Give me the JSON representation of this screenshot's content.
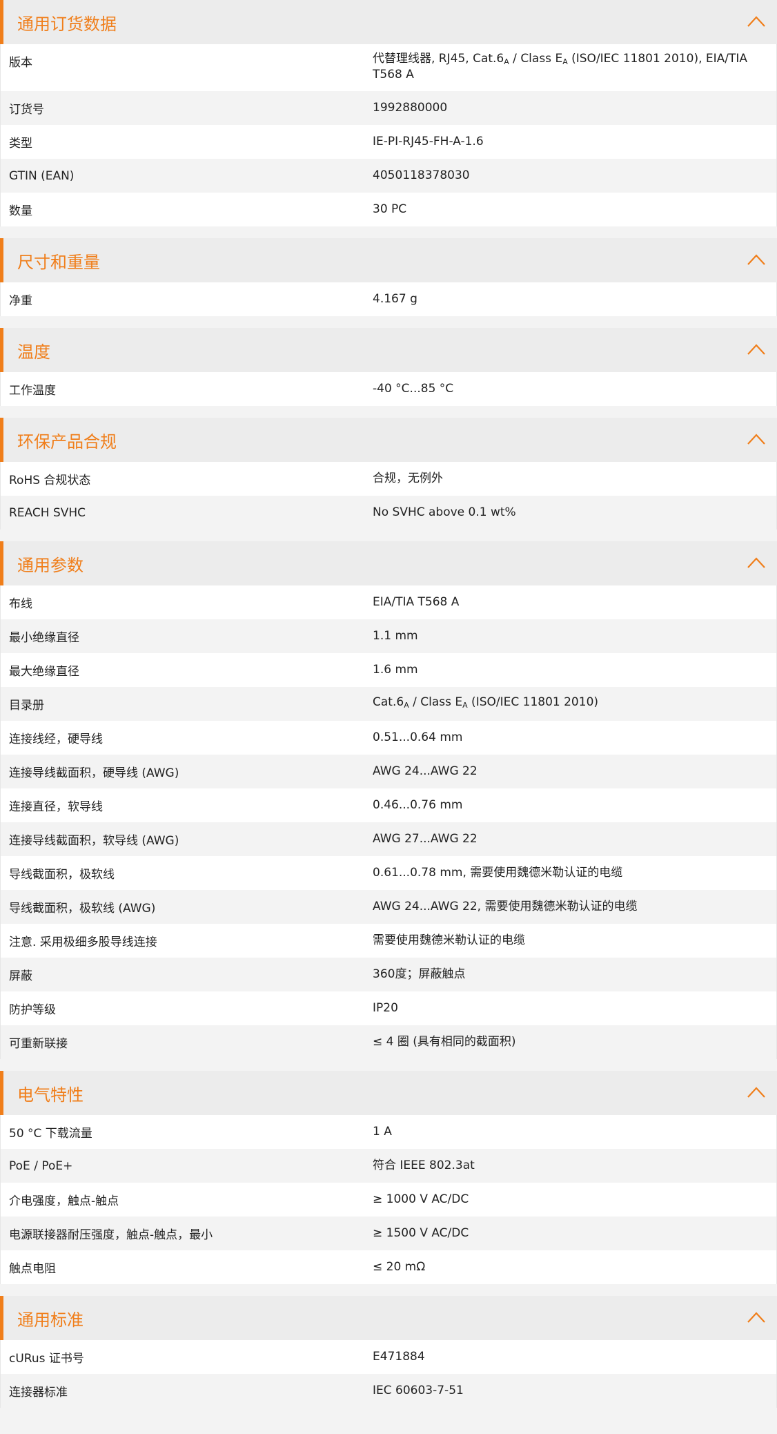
{
  "accent_color": "#f07e1a",
  "icons": {
    "section_toggle": "chevron-up-icon"
  },
  "sections": [
    {
      "id": "general-order",
      "title": "通用订货数据",
      "rows": [
        {
          "label": "版本",
          "value_parts": [
            {
              "t": "代替理线器, RJ45, Cat.6"
            },
            {
              "sub": "A"
            },
            {
              "t": " / Class E"
            },
            {
              "sub": "A"
            },
            {
              "t": " (ISO/IEC 11801 2010), EIA/TIA T568 A"
            }
          ]
        },
        {
          "label": "订货号",
          "value": "1992880000"
        },
        {
          "label": "类型",
          "value": "IE-PI-RJ45-FH-A-1.6"
        },
        {
          "label": "GTIN (EAN)",
          "value": "4050118378030"
        },
        {
          "label": "数量",
          "value": "30  PC"
        }
      ]
    },
    {
      "id": "dimensions-weight",
      "title": "尺寸和重量",
      "rows": [
        {
          "label": "净重",
          "value": "4.167  g"
        }
      ]
    },
    {
      "id": "temperature",
      "title": "温度",
      "rows": [
        {
          "label": "工作温度",
          "value": "-40 °C...85 °C"
        }
      ]
    },
    {
      "id": "environmental",
      "title": "环保产品合规",
      "rows": [
        {
          "label": "RoHS 合规状态",
          "value": "合规，无例外"
        },
        {
          "label": "REACH SVHC",
          "value": "No SVHC above 0.1 wt%"
        }
      ]
    },
    {
      "id": "general-params",
      "title": "通用参数",
      "rows": [
        {
          "label": "布线",
          "value": "EIA/TIA T568 A"
        },
        {
          "label": "最小绝缘直径",
          "value": "1.1  mm"
        },
        {
          "label": "最大绝缘直径",
          "value": "1.6  mm"
        },
        {
          "label": "目录册",
          "value_parts": [
            {
              "t": "Cat.6"
            },
            {
              "sub": "A"
            },
            {
              "t": " / Class E"
            },
            {
              "sub": "A"
            },
            {
              "t": " (ISO/IEC 11801 2010)"
            }
          ]
        },
        {
          "label": "连接线经，硬导线",
          "value": "0.51...0.64 mm"
        },
        {
          "label": "连接导线截面积，硬导线 (AWG)",
          "value": "AWG 24...AWG 22"
        },
        {
          "label": "连接直径，软导线",
          "value": "0.46...0.76 mm"
        },
        {
          "label": "连接导线截面积，软导线 (AWG)",
          "value": "AWG 27...AWG 22"
        },
        {
          "label": "导线截面积，极软线",
          "value": "0.61...0.78 mm, 需要使用魏德米勒认证的电缆"
        },
        {
          "label": "导线截面积，极软线 (AWG)",
          "value": "AWG 24...AWG 22, 需要使用魏德米勒认证的电缆"
        },
        {
          "label": "注意. 采用极细多股导线连接",
          "value": "需要使用魏德米勒认证的电缆"
        },
        {
          "label": "屏蔽",
          "value": "360度；屏蔽触点"
        },
        {
          "label": "防护等级",
          "value": "IP20"
        },
        {
          "label": "可重新联接",
          "value": "≤ 4 圈 (具有相同的截面积)"
        }
      ]
    },
    {
      "id": "electrical",
      "title": "电气特性",
      "rows": [
        {
          "label": "50 °C 下载流量",
          "value": "1  A"
        },
        {
          "label": "PoE / PoE+",
          "value": "符合 IEEE 802.3at"
        },
        {
          "label": "介电强度，触点-触点",
          "value": "≥ 1000 V AC/DC"
        },
        {
          "label": "电源联接器耐压强度，触点-触点，最小",
          "value": "≥ 1500 V AC/DC"
        },
        {
          "label": "触点电阻",
          "value": "≤ 20 mΩ"
        }
      ]
    },
    {
      "id": "general-standards",
      "title": "通用标准",
      "rows": [
        {
          "label": "cURus 证书号",
          "value": "E471884"
        },
        {
          "label": "连接器标准",
          "value": "IEC 60603-7-51"
        }
      ]
    }
  ]
}
